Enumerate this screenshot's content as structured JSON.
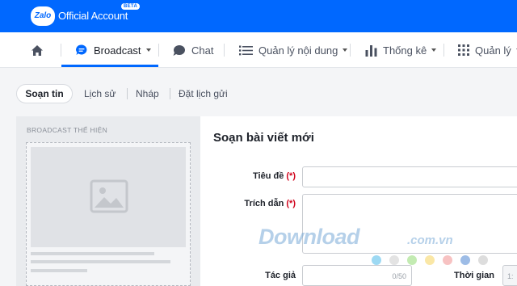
{
  "header": {
    "logo_text": "Zalo",
    "brand": "Official Account",
    "badge": "BETA",
    "bg_color": "#0068ff"
  },
  "nav": {
    "home_icon": "home-icon",
    "items": [
      {
        "label": "Broadcast",
        "icon": "chat-bubble-icon",
        "dropdown": true,
        "active": true
      },
      {
        "label": "Chat",
        "icon": "chat-icon",
        "dropdown": false
      },
      {
        "label": "Quản lý nội dung",
        "icon": "list-icon",
        "dropdown": true
      },
      {
        "label": "Thống kê",
        "icon": "bar-chart-icon",
        "dropdown": true
      },
      {
        "label": "Quản lý",
        "icon": "grid-icon",
        "dropdown": true
      }
    ]
  },
  "subtabs": {
    "active": "Soạn tin",
    "items": [
      "Lịch sử",
      "Nháp",
      "Đặt lịch gửi"
    ]
  },
  "preview": {
    "title": "BROADCAST THỂ HIỆN",
    "image_icon": "image-placeholder-icon"
  },
  "form": {
    "title": "Soạn bài viết mới",
    "title_label": "Tiêu đề",
    "quote_label": "Trích dẫn",
    "required_mark": "(*)",
    "author_label": "Tác giả",
    "author_counter": "0/50",
    "time_label": "Thời gian",
    "time_value": "1:"
  },
  "watermark": {
    "text": "Download",
    "domain": ".com.vn",
    "dot_colors": [
      "#5bc0eb",
      "#dcdcdc",
      "#9bde7e",
      "#f6d76b",
      "#f29a9a",
      "#5b8fd6",
      "#cfcfcf"
    ]
  }
}
